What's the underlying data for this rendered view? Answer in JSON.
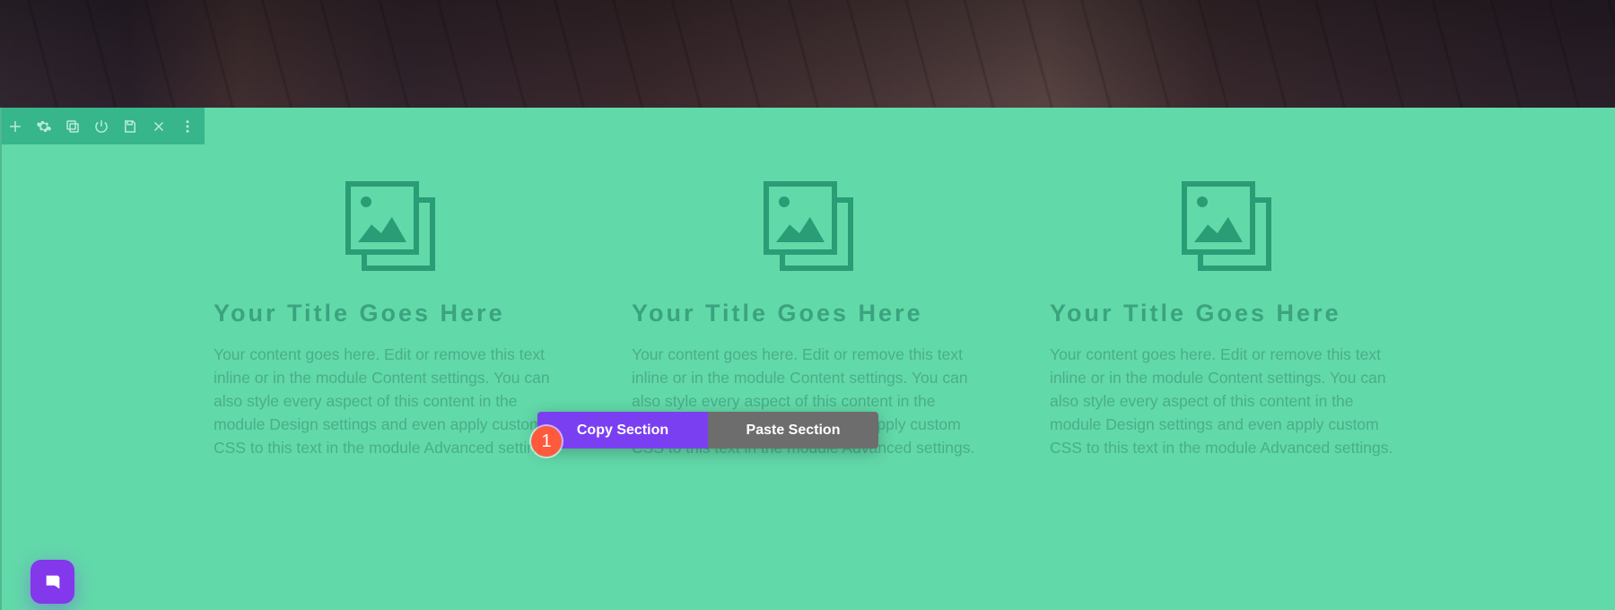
{
  "hero": {},
  "toolbar": {
    "icons": [
      "add",
      "settings",
      "duplicate",
      "power",
      "save",
      "delete",
      "dots"
    ]
  },
  "columns": [
    {
      "title": "Your Title Goes Here",
      "body": "Your content goes here. Edit or remove this text inline or in the module Content settings. You can also style every aspect of this content in the module Design settings and even apply custom CSS to this text in the module Advanced settings."
    },
    {
      "title": "Your Title Goes Here",
      "body": "Your content goes here. Edit or remove this text inline or in the module Content settings. You can also style every aspect of this content in the module Design settings and even apply custom CSS to this text in the module Advanced settings."
    },
    {
      "title": "Your Title Goes Here",
      "body": "Your content goes here. Edit or remove this text inline or in the module Content settings. You can also style every aspect of this content in the module Design settings and even apply custom CSS to this text in the module Advanced settings."
    }
  ],
  "context_menu": {
    "copy_label": "Copy Section",
    "paste_label": "Paste Section"
  },
  "step_badge": "1",
  "colors": {
    "section_bg": "#62d9a9",
    "toolbar_bg": "#37b58b",
    "accent_purple": "#7b3ff2",
    "badge": "#ff5a3c"
  }
}
